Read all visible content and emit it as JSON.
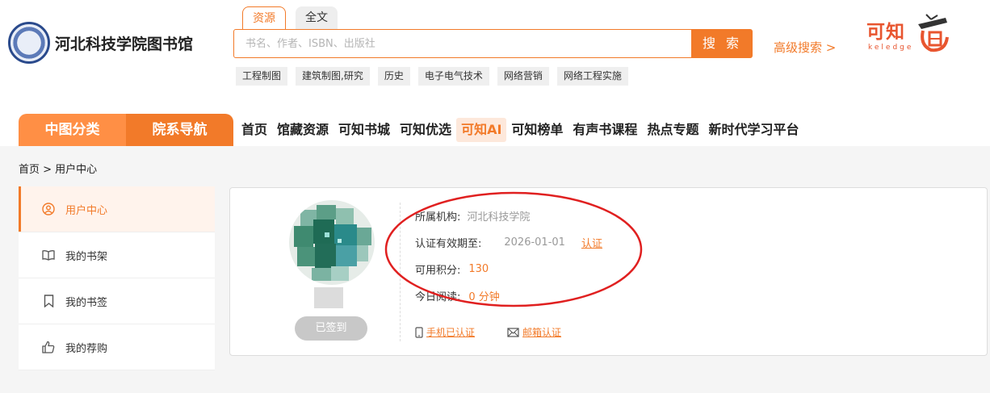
{
  "header": {
    "library_name": "河北科技学院图书馆",
    "search_tabs": [
      {
        "label": "资源",
        "active": true
      },
      {
        "label": "全文",
        "active": false
      }
    ],
    "search_placeholder": "书名、作者、ISBN、出版社",
    "search_button": "搜 索",
    "advanced_search": "高级搜索 >",
    "brand_name": "可知",
    "brand_sub": "keledge",
    "hot_tags": [
      "工程制图",
      "建筑制图,研究",
      "历史",
      "电子电气技术",
      "网络营销",
      "网络工程实施"
    ]
  },
  "nav": {
    "category_button": "中图分类",
    "department_button": "院系导航",
    "items": [
      {
        "label": "首页",
        "active": false
      },
      {
        "label": "馆藏资源",
        "active": false
      },
      {
        "label": "可知书城",
        "active": false
      },
      {
        "label": "可知优选",
        "active": false
      },
      {
        "label": "可知AI",
        "active": true
      },
      {
        "label": "可知榜单",
        "active": false
      },
      {
        "label": "有声书课程",
        "active": false
      },
      {
        "label": "热点专题",
        "active": false
      },
      {
        "label": "新时代学习平台",
        "active": false
      }
    ]
  },
  "breadcrumb": "首页 > 用户中心",
  "sidebar": {
    "items": [
      {
        "label": "用户中心",
        "icon": "user-circle-icon",
        "active": true
      },
      {
        "label": "我的书架",
        "icon": "open-book-icon",
        "active": false
      },
      {
        "label": "我的书签",
        "icon": "bookmark-icon",
        "active": false
      },
      {
        "label": "我的荐购",
        "icon": "thumbs-up-icon",
        "active": false
      }
    ]
  },
  "user": {
    "signed_in_button": "已签到",
    "institution_label": "所属机构:",
    "institution_value": "河北科技学院",
    "validity_label": "认证有效期至:",
    "validity_value": "2026-01-01",
    "validity_action": "认证",
    "points_label": "可用积分:",
    "points_value": "130",
    "reading_label": "今日阅读:",
    "reading_value": "0 分钟",
    "phone_verified": "手机已认证",
    "email_verify": "邮箱认证"
  },
  "colors": {
    "accent": "#f27a29",
    "annotation": "#e02020"
  }
}
